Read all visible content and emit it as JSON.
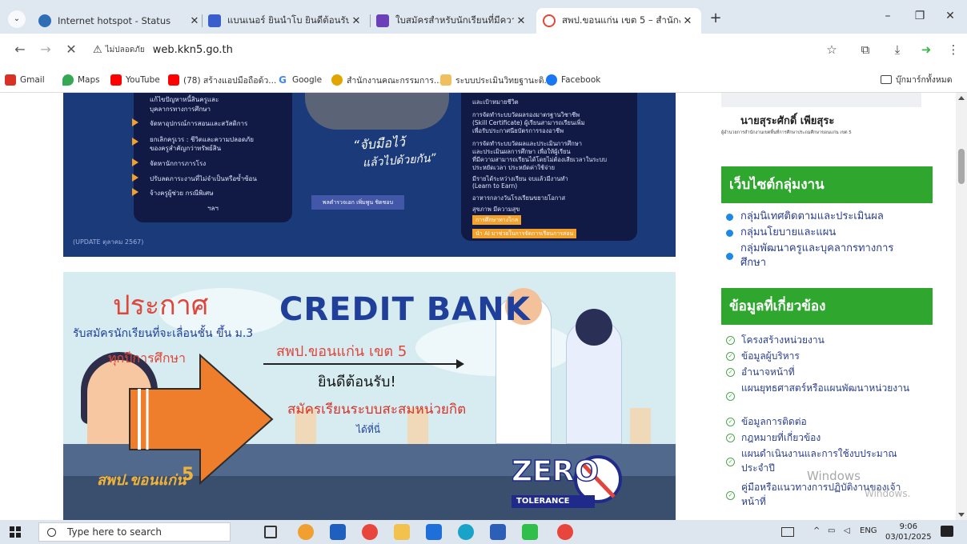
{
  "browser": {
    "tabs": [
      {
        "label": "Internet hotspot - Status",
        "favicon_color": "#2f6db5",
        "active": false
      },
      {
        "label": "แบนเนอร์ ยินนำโบ ยินดีต้อนรับ กรณ",
        "favicon_color": "#3a5fcc",
        "active": false
      },
      {
        "label": "ใบสมัครสำหรับนักเรียนที่มีความต้องก",
        "favicon_color": "#6b3fb8",
        "active": false
      },
      {
        "label": "สพป.ขอนแก่น เขต 5 – สำนักงานเข",
        "favicon_color": "#e0463a",
        "active": true
      }
    ],
    "new_tab": "+",
    "window_controls": {
      "minimize": "–",
      "restore": "❐",
      "close": "✕"
    },
    "address": {
      "security_label": "ไม่ปลอดภัย",
      "url": "web.kkn5.go.th"
    },
    "bookmarks": [
      {
        "label": "Gmail",
        "color": "#d93025"
      },
      {
        "label": "Maps",
        "color": "#34a853"
      },
      {
        "label": "YouTube",
        "color": "#ff0000"
      },
      {
        "label": "(78) สร้างแอปมือถือด้ว...",
        "color": "#ff0000"
      },
      {
        "label": "Google",
        "color": "#4285f4"
      },
      {
        "label": "สำนักงานคณะกรรมการ...",
        "color": "#e2a500"
      },
      {
        "label": "ระบบประเมินวิทยฐานะดิ...",
        "color": "#f0c060"
      },
      {
        "label": "Facebook",
        "color": "#1877f2"
      }
    ],
    "all_bookmarks": "บุ๊กมาร์กทั้งหมด"
  },
  "banner1": {
    "left_items": [
      "แก้ไขปัญหาหนี้สินครูและ",
      "บุคลากรทางการศึกษา",
      "จัดหาอุปกรณ์การสอนและสวัสดิการ",
      "ยกเลิกครูเวร : ชีวิตและความปลอดภัย",
      "ของครูสำคัญกว่าทรัพย์สิน",
      "จัดหานักการภารโรง",
      "ปรับลดภาระงานที่ไม่จำเป็นหรือซ้ำซ้อน",
      "จ้างครูผู้ช่วย กรณีพิเศษ",
      "ฯลฯ"
    ],
    "slogan_1": "“จับมือไว้",
    "slogan_2": "แล้วไปด้วยกัน”",
    "signature_name": "พลตำรวจเอก เพิ่มพูน ชิดชอบ",
    "right_items": [
      "และเป้าหมายชีวิต",
      "การจัดทำระบบวัดผลรองมาตรฐานวิชาชีพ",
      "(Skill Certificate) ผู้เรียนสามารถเรียนเพิ่ม",
      "เพื่อรับประกาศนียบัตรการรองอาชีพ",
      "การจัดทำระบบวัดผลและประเมินการศึกษา",
      "และประเมินผลการศึกษา เพื่อให้ผู้เรียน",
      "ที่มีความสามารถเรียนได้โดยไม่ต้องเสียเวลาในระบบ",
      "ประหยัดเวลา ประหยัดค่าใช้จ่าย",
      "มีรายได้ระหว่างเรียน จบแล้วมีงานทำ",
      "(Learn to Earn)",
      "อาหารกลางวันโรงเรียนขยายโอกาส",
      "สุขภาพ มีความสุข"
    ],
    "right_tags": [
      "การศึกษาทางไกล",
      "นำ AI มาช่วยในการจัดการเรียนการสอน"
    ],
    "update": "(UPDATE ตุลาคม 2567)"
  },
  "banner2": {
    "title": "ประกาศ",
    "sub": "รับสมัครนักเรียนที่จะเลื่อนชั้น ขึ้น ม.3",
    "sub2": "ทุกปีการศึกษา",
    "credit": "CREDIT BANK",
    "area": "สพป.ขอนแก่น เขต 5",
    "welcome": "ยินดีต้อนรับ!",
    "apply": "สมัครเรียนระบบสะสมหน่วยกิต",
    "here": "ได้ที่นี่"
  },
  "banner3": {
    "logo": "สพป.ขอนแก่น",
    "logo_num": "5",
    "zero": "ZERO",
    "tolerance": "TOLERANCE"
  },
  "sidebar": {
    "director_name": "นายสุระศักดิ์ เพียสุระ",
    "director_title": "ผู้อำนวยการสำนักงานเขตพื้นที่การศึกษาประถมศึกษาขอนแก่น เขต 5",
    "group_heading": "เว็บไซต์กลุ่มงาน",
    "group_links": [
      "กลุ่มนิเทศติดตามและประเมินผล",
      "กลุ่มนโยบายและแผน",
      "กลุ่มพัฒนาครูและบุคลากรทางการศึกษา"
    ],
    "info_heading": "ข้อมูลที่เกี่ยวข้อง",
    "info_links": [
      "โครงสร้างหน่วยงาน",
      "ข้อมูลผู้บริหาร",
      "อำนาจหน้าที่",
      "แผนยุทธศาสตร์หรือแผนพัฒนาหน่วยงาน",
      "ข้อมูลการติดต่อ",
      "กฎหมายที่เกี่ยวข้อง",
      "แผนดำเนินงานและการใช้งบประมาณประจำปี",
      "คู่มือหรือแนวทางการปฏิบัติงานของเจ้าหน้าที่"
    ]
  },
  "watermark": {
    "line1": "Windows",
    "line2": "Windows."
  },
  "taskbar": {
    "search_placeholder": "Type here to search",
    "lang": "ENG",
    "time": "9:06",
    "date": "03/01/2025"
  }
}
